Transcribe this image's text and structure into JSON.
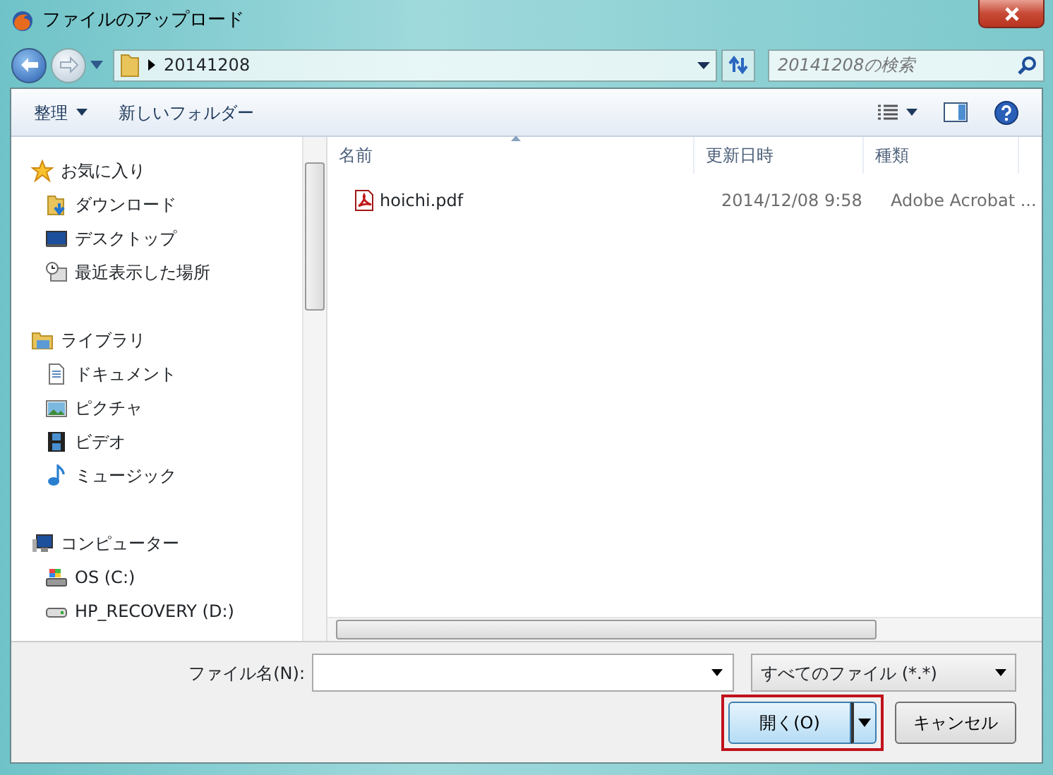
{
  "window": {
    "title": "ファイルのアップロード"
  },
  "address": {
    "crumb": "20141208"
  },
  "search": {
    "placeholder": "20141208の検索"
  },
  "toolbar": {
    "organize": "整理",
    "new_folder": "新しいフォルダー"
  },
  "sidebar": {
    "groups": [
      {
        "label": "お気に入り",
        "kind": "star",
        "children": [
          {
            "label": "ダウンロード",
            "kind": "download"
          },
          {
            "label": "デスクトップ",
            "kind": "desktop"
          },
          {
            "label": "最近表示した場所",
            "kind": "recent"
          }
        ]
      },
      {
        "label": "ライブラリ",
        "kind": "library",
        "children": [
          {
            "label": "ドキュメント",
            "kind": "document"
          },
          {
            "label": "ピクチャ",
            "kind": "picture"
          },
          {
            "label": "ビデオ",
            "kind": "video"
          },
          {
            "label": "ミュージック",
            "kind": "music"
          }
        ]
      },
      {
        "label": "コンピューター",
        "kind": "computer",
        "children": [
          {
            "label": "OS (C:)",
            "kind": "os-drive"
          },
          {
            "label": "HP_RECOVERY (D:)",
            "kind": "drive"
          }
        ]
      }
    ]
  },
  "table": {
    "columns": [
      {
        "label": "名前",
        "sorted": true
      },
      {
        "label": "更新日時",
        "sorted": false
      },
      {
        "label": "種類",
        "sorted": false
      }
    ],
    "rows": [
      {
        "name": "hoichi.pdf",
        "modified": "2014/12/08 9:58",
        "type": "Adobe Acrobat ...",
        "selected": false
      }
    ]
  },
  "footer": {
    "filename_label": "ファイル名(N):",
    "filter": "すべてのファイル (*.*)",
    "open": "開く(O)",
    "open_highlighted": true,
    "cancel": "キャンセル"
  }
}
